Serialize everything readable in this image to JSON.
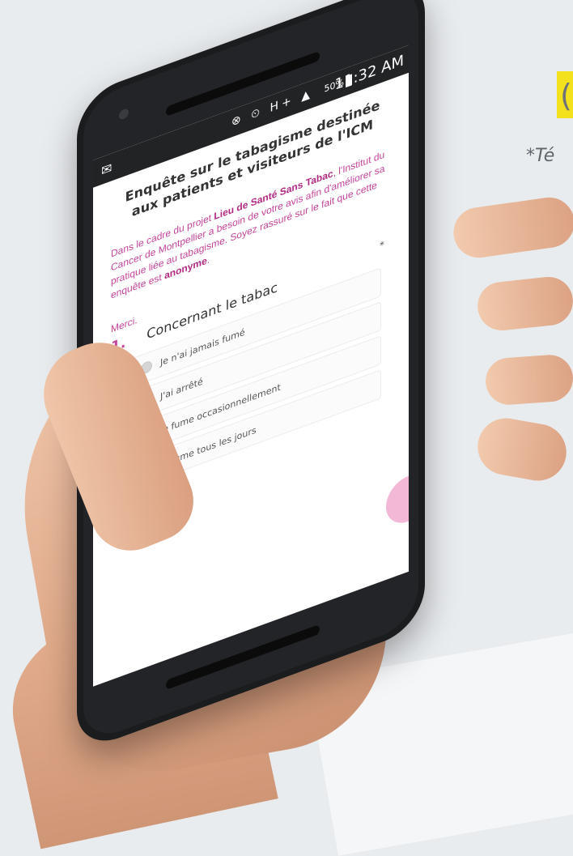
{
  "header_fragment": {
    "mark_text": "(",
    "italic_text": "*Té"
  },
  "status_bar": {
    "mail_icon": "mail-icon",
    "icons_text": "⊗ ⏲ H+ ▲",
    "battery_percent": "50%",
    "time": "11:32 AM"
  },
  "survey": {
    "title": "Enquête sur le tabagisme destinée aux patients et visiteurs de l'ICM",
    "intro": {
      "part1": "Dans le cadre du projet ",
      "bold1": "Lieu de Santé Sans Tabac",
      "part2": ", l'Institut du Cancer de Montpellier a besoin de votre avis afin d'améliorer sa pratique liée au tabagisme. Soyez rassuré sur le fait que cette enquête est ",
      "bold2": "anonyme",
      "part3": "."
    },
    "required_marker": "*",
    "thanks": "Merci.",
    "question": {
      "number": "1.",
      "text": "Concernant le tabac",
      "options": [
        "Je n'ai jamais fumé",
        "J'ai arrêté",
        "Je fume occasionnellement",
        "Je fume tous les jours"
      ]
    }
  },
  "colors": {
    "accent": "#c2449b",
    "accent_bold": "#b12a82",
    "status_bar": "#222325",
    "phone_body": "#1b1c1e",
    "highlight": "#f4e11e"
  }
}
